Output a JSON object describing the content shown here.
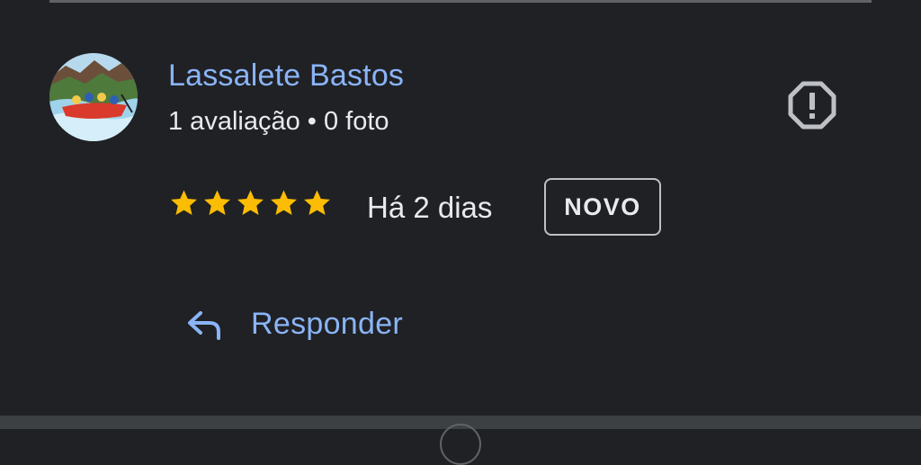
{
  "review": {
    "reviewer_name": "Lassalete Bastos",
    "reviewer_meta": "1 avaliação • 0 foto",
    "rating": 5,
    "rating_max": 5,
    "time_ago": "Há 2 dias",
    "badge": "NOVO",
    "avatar": "rafting-photo-avatar"
  },
  "actions": {
    "reply_label": "Responder",
    "reply_icon": "reply-arrow-icon",
    "report_icon": "report-octagon-icon"
  },
  "colors": {
    "background": "#202124",
    "link_blue": "#8ab4f8",
    "star_yellow": "#fbbc04",
    "text_primary": "#e8eaed",
    "icon_gray": "#bdc1c6"
  }
}
